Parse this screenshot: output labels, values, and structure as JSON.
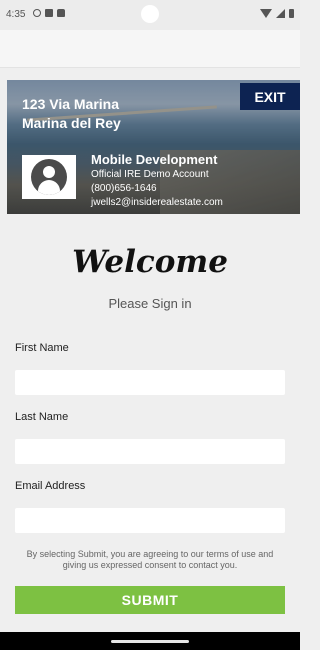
{
  "status_bar": {
    "time": "4:35"
  },
  "listing": {
    "address_line1": "123 Via Marina",
    "address_line2": "Marina del Rey",
    "exit_label": "EXIT"
  },
  "agent": {
    "name": "Mobile Development",
    "company": "Official IRE Demo Account",
    "phone": "(800)656-1646",
    "email": "jwells2@insiderealestate.com"
  },
  "form": {
    "welcome": "Welcome",
    "subtitle": "Please Sign in",
    "fields": [
      {
        "label": "First Name",
        "value": ""
      },
      {
        "label": "Last Name",
        "value": ""
      },
      {
        "label": "Email Address",
        "value": ""
      }
    ],
    "terms": "By selecting Submit, you are agreeing to our terms of use and giving us expressed consent to contact you.",
    "submit_label": "SUBMIT"
  },
  "colors": {
    "exit_button": "#0d2352",
    "submit_button": "#7dc142",
    "background": "#efefef"
  },
  "icons": [
    "info-icon",
    "storage-icon",
    "lock-icon",
    "wifi-icon",
    "signal-icon",
    "battery-icon",
    "avatar-icon"
  ]
}
